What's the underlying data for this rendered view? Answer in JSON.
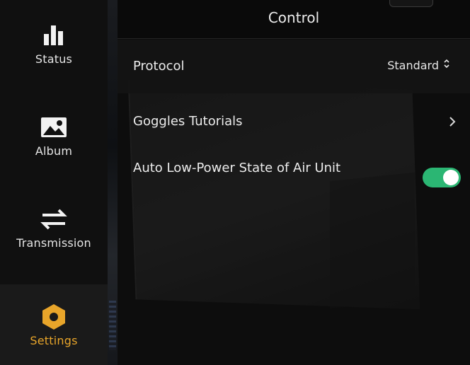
{
  "sidebar": {
    "items": [
      {
        "label": "Status",
        "icon": "bar-chart-icon",
        "active": false
      },
      {
        "label": "Album",
        "icon": "image-icon",
        "active": false
      },
      {
        "label": "Transmission",
        "icon": "transfer-arrows-icon",
        "active": false
      },
      {
        "label": "Settings",
        "icon": "hexagon-gear-icon",
        "active": true
      }
    ]
  },
  "header": {
    "title": "Control"
  },
  "settings": {
    "protocol": {
      "label": "Protocol",
      "value": "Standard"
    },
    "tutorials": {
      "label": "Goggles Tutorials"
    },
    "low_power": {
      "label": "Auto Low-Power State of Air Unit",
      "enabled": true
    }
  },
  "colors": {
    "accent": "#e8a52a",
    "toggle_on": "#2bb673",
    "text": "#ececec",
    "background": "#0d0d0d"
  }
}
